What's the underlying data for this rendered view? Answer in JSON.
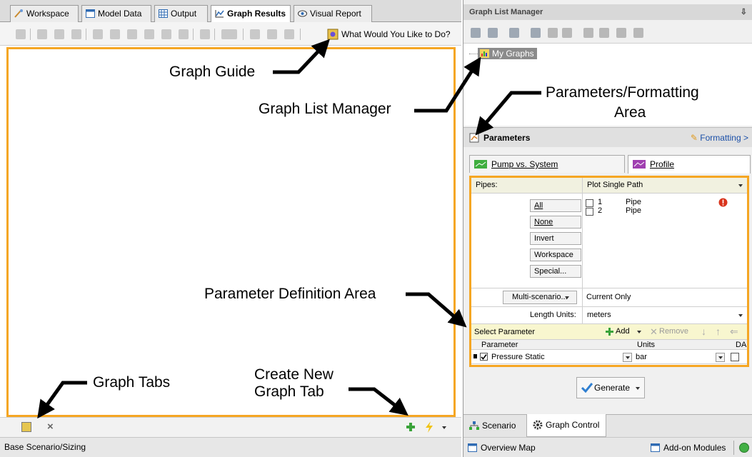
{
  "tabs": [
    {
      "label": "Workspace"
    },
    {
      "label": "Model Data"
    },
    {
      "label": "Output"
    },
    {
      "label": "Graph Results",
      "active": true
    },
    {
      "label": "Visual Report"
    }
  ],
  "toolbar": {
    "what_would_you_like": "What Would You Like to Do?"
  },
  "status_left": "Base Scenario/Sizing",
  "graph_tab_close": "×",
  "graph_list_manager": {
    "title": "Graph List Manager",
    "pin": "⇩",
    "tree_root": "My Graphs"
  },
  "parameters": {
    "title": "Parameters",
    "formatting_link": "Formatting >",
    "subtabs": [
      {
        "label": "Pump vs. System"
      },
      {
        "label": "Profile"
      }
    ],
    "pipes_label": "Pipes:",
    "pipes_mode": "Plot Single Path",
    "selection_buttons": [
      "All",
      "None",
      "Invert",
      "Workspace",
      "Special..."
    ],
    "pipes": [
      {
        "id": "1",
        "type": "Pipe",
        "warning": true
      },
      {
        "id": "2",
        "type": "Pipe",
        "warning": false
      }
    ],
    "multi_scenario_label": "Multi-scenario...",
    "multi_scenario_value": "Current Only",
    "length_units_label": "Length Units:",
    "length_units_value": "meters",
    "select_parameter_label": "Select Parameter",
    "add_label": "Add",
    "remove_label": "Remove",
    "table_headers": {
      "parameter": "Parameter",
      "units": "Units",
      "da": "DA"
    },
    "table_rows": [
      {
        "parameter": "Pressure Static",
        "units": "bar",
        "checked": true
      }
    ]
  },
  "generate_label": "Generate",
  "bottom_tabs": [
    {
      "label": "Scenario"
    },
    {
      "label": "Graph Control"
    }
  ],
  "status_right": {
    "overview_map": "Overview Map",
    "addon_modules": "Add-on Modules"
  },
  "annotations": {
    "graph_guide": "Graph Guide",
    "graph_list_manager": "Graph List Manager",
    "params_formatting_line1": "Parameters/Formatting",
    "params_formatting_line2": "Area",
    "param_definition": "Parameter Definition Area",
    "graph_tabs": "Graph Tabs",
    "create_new_line1": "Create New",
    "create_new_line2": "Graph Tab"
  },
  "colors": {
    "highlight_border": "#f5a623",
    "selected_tree": "#8b8b8b",
    "link": "#1a4fa8"
  }
}
